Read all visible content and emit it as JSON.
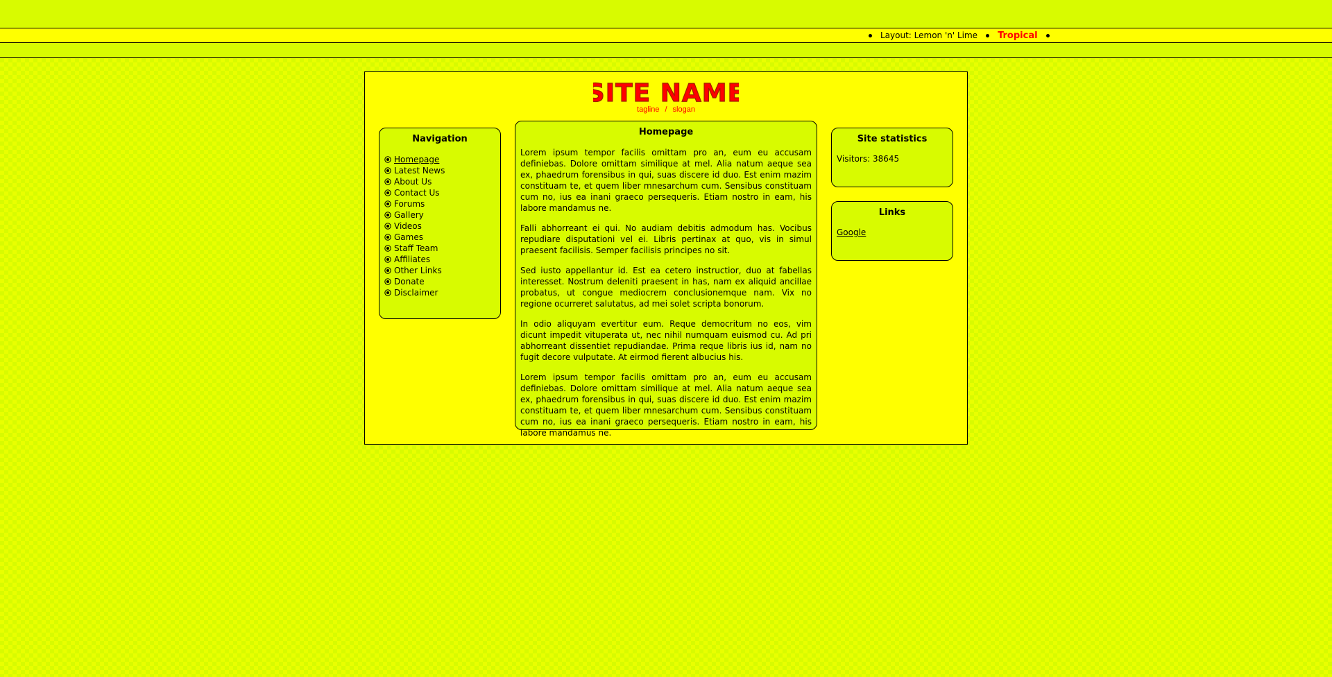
{
  "layout_bar": {
    "layout_label": "Layout: Lemon 'n' Lime",
    "alt_layout": "Tropical"
  },
  "header": {
    "site_name": "SITE NAME",
    "tagline": "tagline",
    "slogan": "slogan",
    "tagline_separator": "/"
  },
  "navigation": {
    "title": "Navigation",
    "items": [
      {
        "label": "Homepage"
      },
      {
        "label": "Latest News"
      },
      {
        "label": "About Us"
      },
      {
        "label": "Contact Us"
      },
      {
        "label": "Forums"
      },
      {
        "label": "Gallery"
      },
      {
        "label": "Videos"
      },
      {
        "label": "Games"
      },
      {
        "label": "Staff Team"
      },
      {
        "label": "Affiliates"
      },
      {
        "label": "Other Links"
      },
      {
        "label": "Donate"
      },
      {
        "label": "Disclaimer"
      }
    ]
  },
  "main": {
    "title": "Homepage",
    "paragraphs": [
      "Lorem ipsum tempor facilis omittam pro an, eum eu accusam definiebas. Dolore omittam similique at mel. Alia natum aeque sea ex, phaedrum forensibus in qui, suas discere id duo. Est enim mazim constituam te, et quem liber mnesarchum cum. Sensibus constituam cum no, ius ea inani graeco persequeris. Etiam nostro in eam, his labore mandamus ne.",
      "Falli abhorreant ei qui. No audiam debitis admodum has. Vocibus repudiare disputationi vel ei. Libris pertinax at quo, vis in simul praesent facilisis. Semper facilisis principes no sit.",
      "Sed iusto appellantur id. Est ea cetero instructior, duo at fabellas interesset. Nostrum deleniti praesent in has, nam ex aliquid ancillae probatus, ut congue mediocrem conclusionemque nam. Vix no regione ocurreret salutatus, ad mei solet scripta bonorum.",
      "In odio aliquyam evertitur eum. Reque democritum no eos, vim dicunt impedit vituperata ut, nec nihil numquam euismod cu. Ad pri abhorreant dissentiet repudiandae. Prima reque libris ius id, nam no fugit decore vulputate. At eirmod fierent albucius his.",
      "Lorem ipsum tempor facilis omittam pro an, eum eu accusam definiebas. Dolore omittam similique at mel. Alia natum aeque sea ex, phaedrum forensibus in qui, suas discere id duo. Est enim mazim constituam te, et quem liber mnesarchum cum. Sensibus constituam cum no, ius ea inani graeco persequeris. Etiam nostro in eam, his labore mandamus ne."
    ]
  },
  "stats": {
    "title": "Site statistics",
    "visitors_text": "Visitors: 38645"
  },
  "links": {
    "title": "Links",
    "items": [
      {
        "label": "Google"
      }
    ]
  },
  "colors": {
    "background": "#d8fb00",
    "panel": "#ffff00",
    "accent": "#ff0000"
  }
}
